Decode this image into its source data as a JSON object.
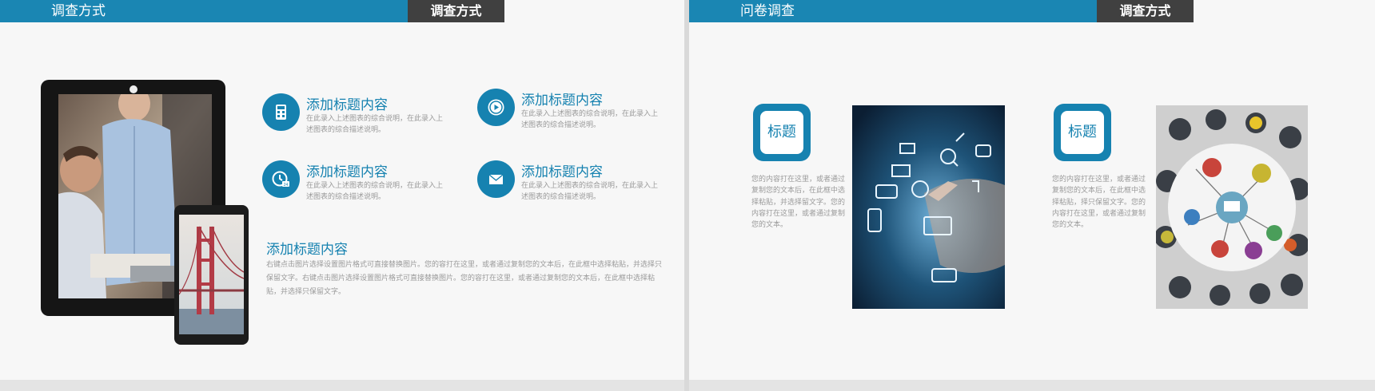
{
  "slide1": {
    "header": {
      "title": "调查方式",
      "tag": "调查方式"
    },
    "features": [
      {
        "title": "添加标题内容",
        "desc": "在此录入上述图表的综合说明，在此录入上述图表的综合描述说明。",
        "icon": "calculator-icon"
      },
      {
        "title": "添加标题内容",
        "desc": "在此录入上述图表的综合说明，在此录入上述图表的综合描述说明。",
        "icon": "play-icon"
      },
      {
        "title": "添加标题内容",
        "desc": "在此录入上述图表的综合说明，在此录入上述图表的综合描述说明。",
        "icon": "clock-icon"
      },
      {
        "title": "添加标题内容",
        "desc": "在此录入上述图表的综合说明，在此录入上述图表的综合描述说明。",
        "icon": "mail-icon"
      }
    ],
    "paragraph": {
      "title": "添加标题内容",
      "text": "右键点击图片选择设置图片格式可直接替换图片。您的容打在这里，或者通过复制您的文本后，在此框中选择粘贴，并选择只保留文字。右键点击图片选择设置图片格式可直接替换图片。您的容打在这里，或者通过复制您的文本后，在此框中选择粘贴，并选择只保留文字。"
    }
  },
  "slide2": {
    "header": {
      "title": "问卷调查",
      "tag": "调查方式"
    },
    "items": [
      {
        "label": "标题",
        "desc": "您的内容打在这里，或者通过复制您的文本后，在此框中选择粘贴，并选择留文字。您的内容打在这里，或者通过复制您的文本。"
      },
      {
        "label": "标题",
        "desc": "您的内容打在这里，或者通过复制您的文本后，在此框中选择粘贴，择只保留文字。您的内容打在这里，或者通过复制您的文本。"
      }
    ]
  },
  "colors": {
    "accent": "#1682b0",
    "header": "#1a86b3",
    "tag": "#404040",
    "muted_text": "#9a9a9a"
  }
}
